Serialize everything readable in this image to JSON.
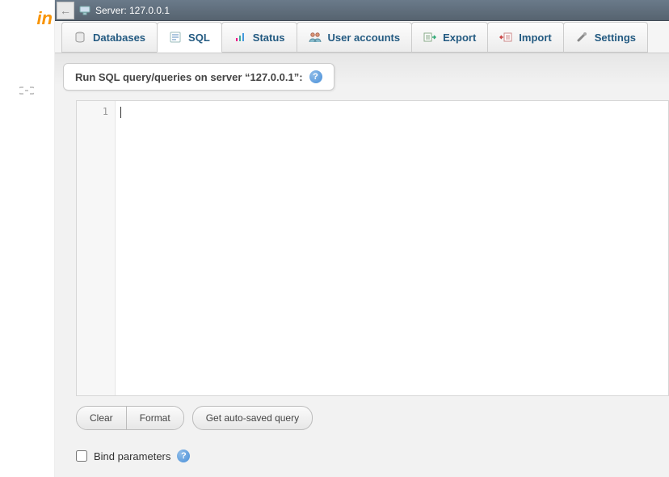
{
  "logo_fragment": "in",
  "breadcrumb": {
    "server_label": "Server: 127.0.0.1"
  },
  "tabs": [
    {
      "label": "Databases",
      "icon": "database-icon",
      "active": false
    },
    {
      "label": "SQL",
      "icon": "sql-icon",
      "active": true
    },
    {
      "label": "Status",
      "icon": "status-icon",
      "active": false
    },
    {
      "label": "User accounts",
      "icon": "user-accounts-icon",
      "active": false
    },
    {
      "label": "Export",
      "icon": "export-icon",
      "active": false
    },
    {
      "label": "Import",
      "icon": "import-icon",
      "active": false
    },
    {
      "label": "Settings",
      "icon": "settings-icon",
      "active": false
    }
  ],
  "panel": {
    "title": "Run SQL query/queries on server “127.0.0.1”:"
  },
  "editor": {
    "line_number": "1",
    "content": ""
  },
  "buttons": {
    "clear": "Clear",
    "format": "Format",
    "get_autosaved": "Get auto-saved query"
  },
  "bind_params": {
    "label": "Bind parameters",
    "checked": false
  }
}
